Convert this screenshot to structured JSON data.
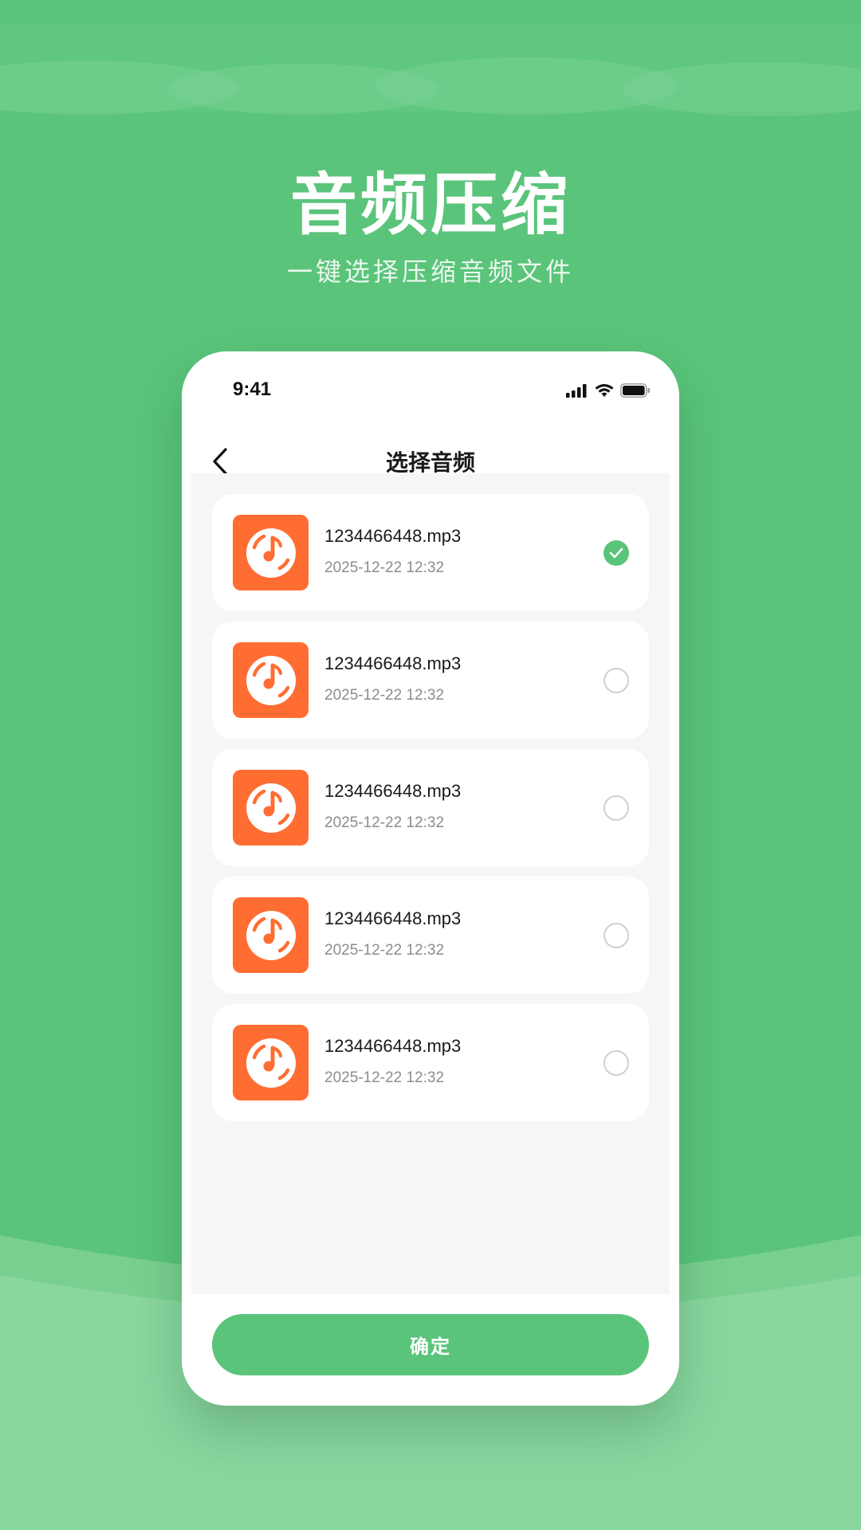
{
  "promo": {
    "title": "音频压缩",
    "subtitle": "一键选择压缩音频文件"
  },
  "status_bar": {
    "time": "9:41",
    "icons": [
      "signal-icon",
      "wifi-icon",
      "battery-icon"
    ]
  },
  "nav": {
    "back_icon": "chevron-left-icon",
    "title": "选择音频"
  },
  "files": [
    {
      "name": "1234466448.mp3",
      "date": "2025-12-22 12:32",
      "selected": true
    },
    {
      "name": "1234466448.mp3",
      "date": "2025-12-22 12:32",
      "selected": false
    },
    {
      "name": "1234466448.mp3",
      "date": "2025-12-22 12:32",
      "selected": false
    },
    {
      "name": "1234466448.mp3",
      "date": "2025-12-22 12:32",
      "selected": false
    },
    {
      "name": "1234466448.mp3",
      "date": "2025-12-22 12:32",
      "selected": false
    }
  ],
  "confirm_label": "确定",
  "colors": {
    "brand_green": "#5ac47a",
    "file_icon_orange": "#ff6d33",
    "list_background": "#f6f6f6"
  }
}
